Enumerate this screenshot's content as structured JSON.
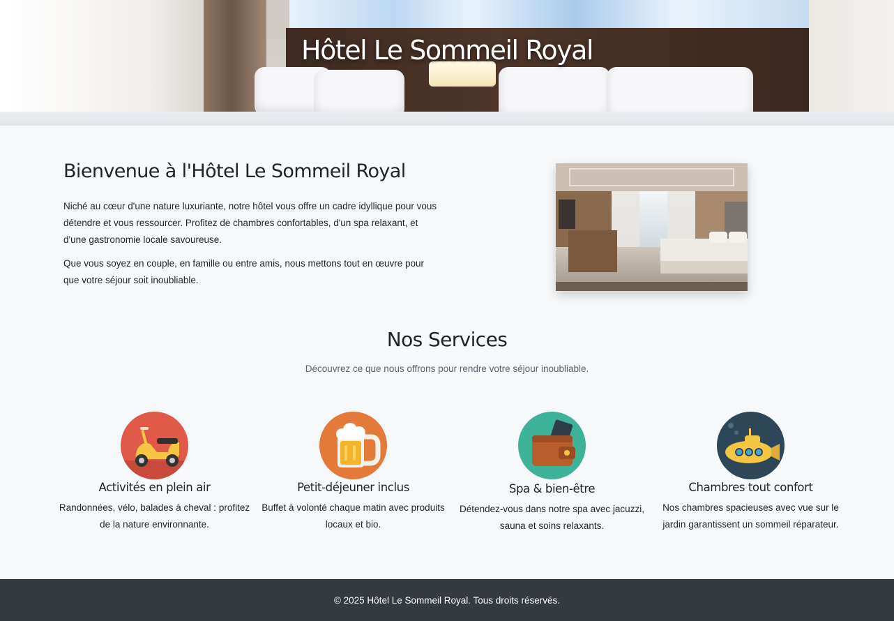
{
  "hero": {
    "title": "Hôtel Le Sommeil Royal"
  },
  "welcome": {
    "heading": "Bienvenue à l'Hôtel Le Sommeil Royal",
    "paragraph1": "Niché au cœur d'une nature luxuriante, notre hôtel vous offre un cadre idyllique pour vous détendre et vous ressourcer. Profitez de chambres confortables, d'un spa relaxant, et d'une gastronomie locale savoureuse.",
    "paragraph2": "Que vous soyez en couple, en famille ou entre amis, nous mettons tout en œuvre pour que votre séjour soit inoubliable."
  },
  "services": {
    "title": "Nos Services",
    "subtitle": "Découvrez ce que nous offrons pour rendre votre séjour inoubliable.",
    "items": [
      {
        "icon": "scooter-icon",
        "title": "Activités en plein air",
        "text": "Randonnées, vélo, balades à cheval : profitez de la nature environnante.",
        "color": "#e05a47"
      },
      {
        "icon": "beer-mug-icon",
        "title": "Petit-déjeuner inclus",
        "text": "Buffet à volonté chaque matin avec produits locaux et bio.",
        "color": "#e47a3a"
      },
      {
        "icon": "wallet-icon",
        "title": "Spa & bien-être",
        "text": "Détendez-vous dans notre spa avec jacuzzi, sauna et soins relaxants.",
        "color": "#3fb39a"
      },
      {
        "icon": "submarine-icon",
        "title": "Chambres tout confort",
        "text": "Nos chambres spacieuses avec vue sur le jardin garantissent un sommeil réparateur.",
        "color": "#2d4758"
      }
    ]
  },
  "footer": {
    "text": "© 2025 Hôtel Le Sommeil Royal. Tous droits réservés."
  }
}
